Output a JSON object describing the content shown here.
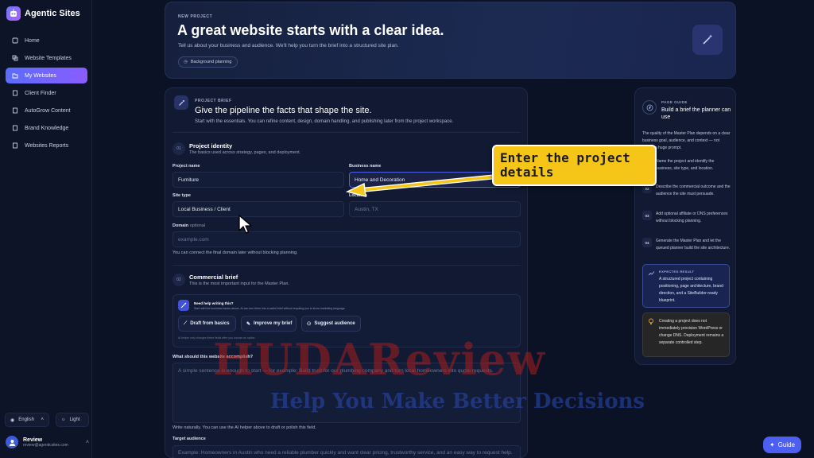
{
  "brand": {
    "name": "Agentic Sites"
  },
  "sidebar": {
    "items": [
      {
        "label": "Home",
        "icon": "home-icon"
      },
      {
        "label": "Website Templates",
        "icon": "templates-icon"
      },
      {
        "label": "My Websites",
        "icon": "folder-icon",
        "active": true
      },
      {
        "label": "Client Finder",
        "icon": "document-icon"
      },
      {
        "label": "AutoGrow Content",
        "icon": "document-icon"
      },
      {
        "label": "Brand Knowledge",
        "icon": "document-icon"
      },
      {
        "label": "Websites Reports",
        "icon": "document-icon"
      }
    ],
    "language": "English",
    "theme": "Light",
    "user": {
      "name": "Review",
      "email": "review@agenticsites.com"
    }
  },
  "hero": {
    "eyebrow": "NEW PROJECT",
    "title": "A great website starts with a clear idea.",
    "subtitle": "Tell us about your business and audience. We'll help you turn the brief into a structured site plan.",
    "chip": "Background planning"
  },
  "brief": {
    "eyebrow": "PROJECT BRIEF",
    "title": "Give the pipeline the facts that shape the site.",
    "subtitle": "Start with the essentials. You can refine content, design, domain handling, and publishing later from the project workspace.",
    "identity": {
      "num": "01",
      "title": "Project identity",
      "subtitle": "The basics used across strategy, pages, and deployment.",
      "project_name_label": "Project name",
      "project_name_value": "Furniture",
      "business_name_label": "Business name",
      "business_name_value": "Home and Decoration",
      "site_type_label": "Site type",
      "site_type_value": "Local Business / Client",
      "location_label": "Location",
      "location_placeholder": "Austin, TX",
      "domain_label": "Domain",
      "domain_optional": "optional",
      "domain_placeholder": "example.com",
      "domain_hint": "You can connect the final domain later without blocking planning."
    },
    "commercial": {
      "num": "02",
      "title": "Commercial brief",
      "subtitle": "This is the most important input for the Master Plan.",
      "help_title": "Need help writing this?",
      "help_sub": "Start with the business basics above. AI can turn them into a useful brief without requiring you to know marketing language.",
      "btn_draft": "Draft from basics",
      "btn_improve": "Improve my brief",
      "btn_audience": "Suggest audience",
      "help_note": "AI helper only changes these fields after you choose an option.",
      "accomplish_label": "What should this website accomplish?",
      "accomplish_placeholder": "A simple sentence is enough to start — for example: Build trust for our plumbing company and turn local homeowners into quote requests.",
      "accomplish_hint": "Write naturally. You can use the AI helper above to draft or polish this field.",
      "audience_label": "Target audience",
      "audience_placeholder": "Example: Homeowners in Austin who need a reliable plumber quickly and want clear pricing, trustworthy service, and an easy way to request help."
    }
  },
  "guide": {
    "eyebrow": "PAGE GUIDE",
    "title": "Build a brief the planner can use",
    "intro": "The quality of the Master Plan depends on a clear business goal, audience, and context — not writing a huge prompt.",
    "steps": [
      {
        "num": "01",
        "text": "Name the project and identify the business, site type, and location."
      },
      {
        "num": "02",
        "text": "Describe the commercial outcome and the audience the site must persuade."
      },
      {
        "num": "03",
        "text": "Add optional affiliate or DNS preferences without blocking planning."
      },
      {
        "num": "04",
        "text": "Generate the Master Plan and let the queued planner build the site architecture."
      }
    ],
    "expected_eyebrow": "EXPECTED RESULT",
    "expected_text": "A structured project containing positioning, page architecture, brand direction, and a SiteBuilder-ready blueprint.",
    "warning_text": "Creating a project does not immediately provision WordPress or change DNS. Deployment remains a separate controlled step."
  },
  "callout": {
    "text": "Enter the project details",
    "color": "#f5c518"
  },
  "watermark": {
    "line1": "HUDAReview",
    "line2": "Help You Make Better Decisions"
  },
  "guide_button": "Guide"
}
